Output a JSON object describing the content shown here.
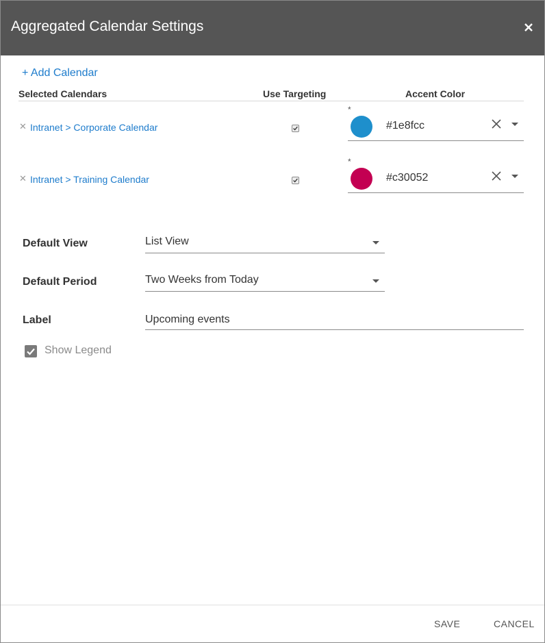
{
  "dialog": {
    "title": "Aggregated Calendar Settings"
  },
  "add_calendar_label": "+ Add Calendar",
  "columns": {
    "selected": "Selected Calendars",
    "targeting": "Use Targeting",
    "accent": "Accent Color"
  },
  "calendars": [
    {
      "name": "Intranet > Corporate Calendar",
      "use_targeting": true,
      "required_mark": "*",
      "accent_color": "#1e8fcc"
    },
    {
      "name": "Intranet > Training Calendar",
      "use_targeting": true,
      "required_mark": "*",
      "accent_color": "#c30052"
    }
  ],
  "form": {
    "default_view": {
      "label": "Default View",
      "value": "List View"
    },
    "default_period": {
      "label": "Default Period",
      "value": "Two Weeks from Today"
    },
    "label_field": {
      "label": "Label",
      "value": "Upcoming events"
    },
    "show_legend": {
      "label": "Show Legend",
      "checked": true
    }
  },
  "footer": {
    "save_label": "SAVE",
    "cancel_label": "CANCEL"
  },
  "colors": {
    "header_bg": "#555555",
    "link": "#1e7ccc"
  }
}
